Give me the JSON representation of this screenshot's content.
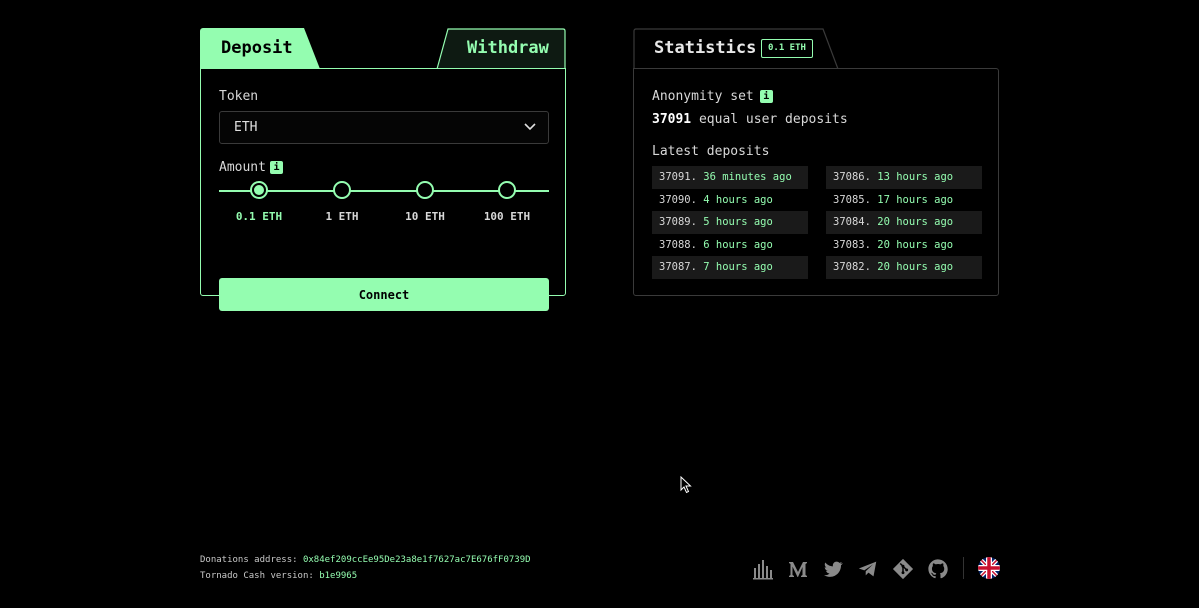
{
  "tabs": {
    "deposit": "Deposit",
    "withdraw": "Withdraw"
  },
  "deposit": {
    "token_label": "Token",
    "token_value": "ETH",
    "amount_label": "Amount",
    "info": "i",
    "amounts": [
      "0.1 ETH",
      "1 ETH",
      "10 ETH",
      "100 ETH"
    ],
    "selected_amount": "0.1 ETH",
    "connect_label": "Connect"
  },
  "stats": {
    "title": "Statistics",
    "badge": "0.1 ETH",
    "anonymity_label": "Anonymity set",
    "info": "i",
    "anonymity_count": "37091",
    "anonymity_suffix": "equal user deposits",
    "latest_label": "Latest deposits",
    "latest_left": [
      {
        "id": "37091.",
        "ago": "36 minutes ago"
      },
      {
        "id": "37090.",
        "ago": "4 hours ago"
      },
      {
        "id": "37089.",
        "ago": "5 hours ago"
      },
      {
        "id": "37088.",
        "ago": "6 hours ago"
      },
      {
        "id": "37087.",
        "ago": "7 hours ago"
      }
    ],
    "latest_right": [
      {
        "id": "37086.",
        "ago": "13 hours ago"
      },
      {
        "id": "37085.",
        "ago": "17 hours ago"
      },
      {
        "id": "37084.",
        "ago": "20 hours ago"
      },
      {
        "id": "37083.",
        "ago": "20 hours ago"
      },
      {
        "id": "37082.",
        "ago": "20 hours ago"
      }
    ]
  },
  "footer": {
    "donations_label": "Donations address:",
    "donations_address": "0x84ef209ccEe95De23a8e1f7627ac7E676fF0739D",
    "version_label": "Tornado Cash version:",
    "version": "b1e9965"
  },
  "social_icons": [
    "stats-icon",
    "medium-icon",
    "twitter-icon",
    "telegram-icon",
    "git-icon",
    "github-icon"
  ],
  "language_flag": "uk-flag-icon",
  "colors": {
    "accent": "#94fdb0",
    "background": "#000000",
    "row_shade": "#1a1a1a",
    "border_muted": "#3a3a3a"
  }
}
